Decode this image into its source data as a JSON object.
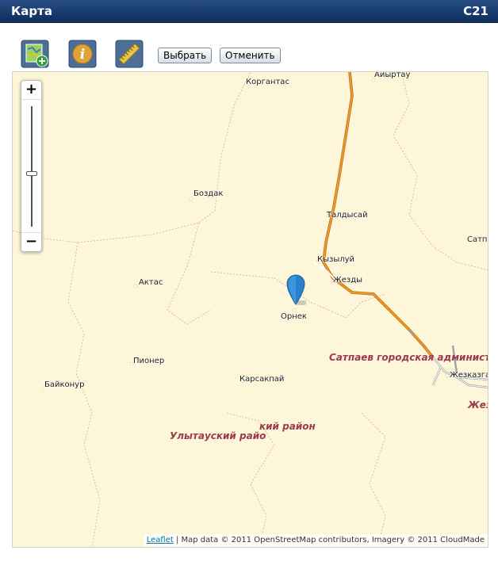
{
  "window": {
    "title": "Карта",
    "code": "C21"
  },
  "toolbar": {
    "tools": [
      {
        "icon": "add-layer-icon"
      },
      {
        "icon": "info-icon"
      },
      {
        "icon": "ruler-icon"
      }
    ],
    "select_label": "Выбрать",
    "cancel_label": "Отменить"
  },
  "map": {
    "zoom_in": "+",
    "zoom_out": "−",
    "places": [
      {
        "name": "Коргантас"
      },
      {
        "name": "Аиыртау"
      },
      {
        "name": "Боздак"
      },
      {
        "name": "Талдысай"
      },
      {
        "name": "Сатп"
      },
      {
        "name": "Кызылуй"
      },
      {
        "name": "Актас"
      },
      {
        "name": "Жезды"
      },
      {
        "name": "Орнек"
      },
      {
        "name": "Пионер"
      },
      {
        "name": "Карсакпай"
      },
      {
        "name": "Байконур"
      },
      {
        "name": "Жезказга"
      }
    ],
    "regions": [
      {
        "name": "Сатпаев городская админист"
      },
      {
        "name": "Улытауский райо"
      },
      {
        "name": "кий район"
      },
      {
        "name": "Жез"
      }
    ],
    "attribution": {
      "leaflet": "Leaflet",
      "text": " | Map data © 2011 OpenStreetMap contributors, Imagery © 2011 CloudMade"
    },
    "colors": {
      "background": "#fdf6d8",
      "road": "#e08a1e",
      "region_label": "#9b3a4f",
      "marker": "#2a81cb"
    }
  }
}
